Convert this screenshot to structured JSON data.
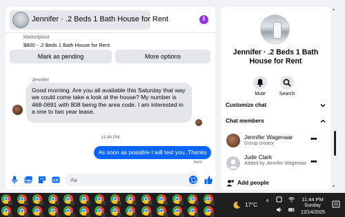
{
  "chat": {
    "title": "Jennifer · .2 Beds 1 Bath House for Rent",
    "marketplace_label": "Marketplace",
    "listing": "$800 - .2 Beds 1 Bath House for Rent",
    "mark_pending_label": "Mark as pending",
    "more_options_label": "More options",
    "sender_name": "Jennifer",
    "incoming_message": "Good morning. Are you all available this Saturday that way we could come take a look at the house? My number is 468-0691 with 808 being the area code. I am interested in a one to two year lease.",
    "timestamp": "11:44 PM",
    "outgoing_message": "As soon as possible I will text you..Thanks",
    "sent_status": "Sent",
    "composer_placeholder": "Aa",
    "accent": "#0866ff"
  },
  "details": {
    "title": "Jennifer · .2 Beds 1 Bath House for Rent",
    "mute_label": "Mute",
    "search_label": "Search",
    "customize_label": "Customize chat",
    "members_label": "Chat members",
    "members": [
      {
        "name": "Jennifer Wagenaar",
        "sub": "Group creator"
      },
      {
        "name": "Jude Clark",
        "sub": "Added by Jennifer Wagenaar"
      }
    ],
    "add_people_label": "Add people"
  },
  "taskbar": {
    "temperature": "17°C",
    "time": "11:44 PM",
    "day": "Sunday",
    "date": "12/14/2025"
  }
}
